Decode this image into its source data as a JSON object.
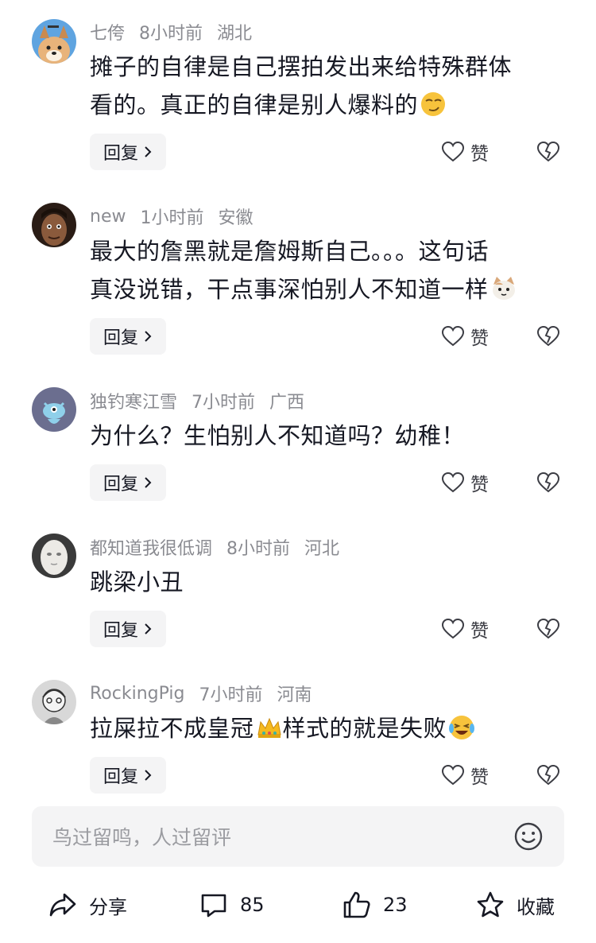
{
  "comments": [
    {
      "user": "七侉",
      "time": "8小时前",
      "location": "湖北",
      "lines": [
        "摊子的自律是自己摆拍发出来给特殊群体",
        "看的。真正的自律是别人爆料的"
      ],
      "emoji": "smirk-emoji",
      "reply_label": "回复",
      "like_label": "赞"
    },
    {
      "user": "new",
      "time": "1小时前",
      "location": "安徽",
      "lines": [
        "最大的詹黑就是詹姆斯自己。。。这句话",
        "真没说错，干点事深怕别人不知道一样"
      ],
      "emoji": "cat-emoji",
      "reply_label": "回复",
      "like_label": "赞"
    },
    {
      "user": "独钓寒江雪",
      "time": "7小时前",
      "location": "广西",
      "lines": [
        "为什么？生怕别人不知道吗？幼稚！"
      ],
      "emoji": "",
      "reply_label": "回复",
      "like_label": "赞"
    },
    {
      "user": "都知道我很低调",
      "time": "8小时前",
      "location": "河北",
      "lines": [
        "跳梁小丑"
      ],
      "emoji": "",
      "reply_label": "回复",
      "like_label": "赞"
    },
    {
      "user": "RockingPig",
      "time": "7小时前",
      "location": "河南",
      "text_before": "拉屎拉不成皇冠",
      "text_after": "样式的就是失败",
      "emoji": "laughing-crying-emoji",
      "inline_emoji": "crown-emoji",
      "reply_label": "回复",
      "like_label": "赞"
    }
  ],
  "input": {
    "placeholder": "鸟过留鸣，人过留评"
  },
  "bottom_bar": {
    "share_label": "分享",
    "comment_count": "85",
    "like_count": "23",
    "collect_label": "收藏"
  },
  "icons": [
    "share-icon",
    "comment-icon",
    "thumbs-up-icon",
    "star-icon",
    "heart-icon",
    "broken-heart-icon",
    "smiley-icon",
    "chevron-right-icon"
  ],
  "colors": {
    "text": "#161823",
    "muted": "#8a8b91",
    "chip_bg": "#f4f4f5"
  }
}
